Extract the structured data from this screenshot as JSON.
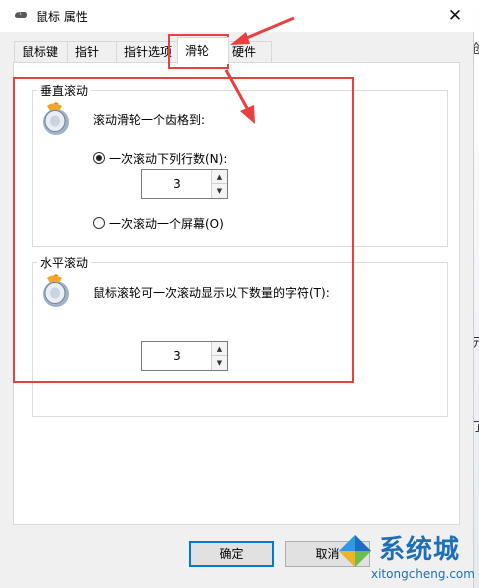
{
  "window": {
    "title": "鼠标 属性",
    "close": "✕"
  },
  "tabs": [
    {
      "label": "鼠标键"
    },
    {
      "label": "指针"
    },
    {
      "label": "指针选项"
    },
    {
      "label": "滑轮",
      "active": true
    },
    {
      "label": "硬件"
    }
  ],
  "vertical_scroll": {
    "group_label": "垂直滚动",
    "description": "滚动滑轮一个齿格到:",
    "option_lines": "一次滚动下列行数(N):",
    "lines_value": "3",
    "option_screen": "一次滚动一个屏幕(O)",
    "selected": "lines"
  },
  "horizontal_scroll": {
    "group_label": "水平滚动",
    "description": "鼠标滚轮可一次滚动显示以下数量的字符(T):",
    "chars_value": "3"
  },
  "buttons": {
    "ok": "确定",
    "cancel": "取消"
  },
  "background_glyphs": [
    "创",
    "元",
    "了"
  ],
  "watermark": {
    "brand": "系统城",
    "url": "xitongcheng.com"
  },
  "colors": {
    "annotation_red": "#e8403f",
    "primary_border": "#0078d7",
    "watermark_blue": "#1c6fb8"
  }
}
